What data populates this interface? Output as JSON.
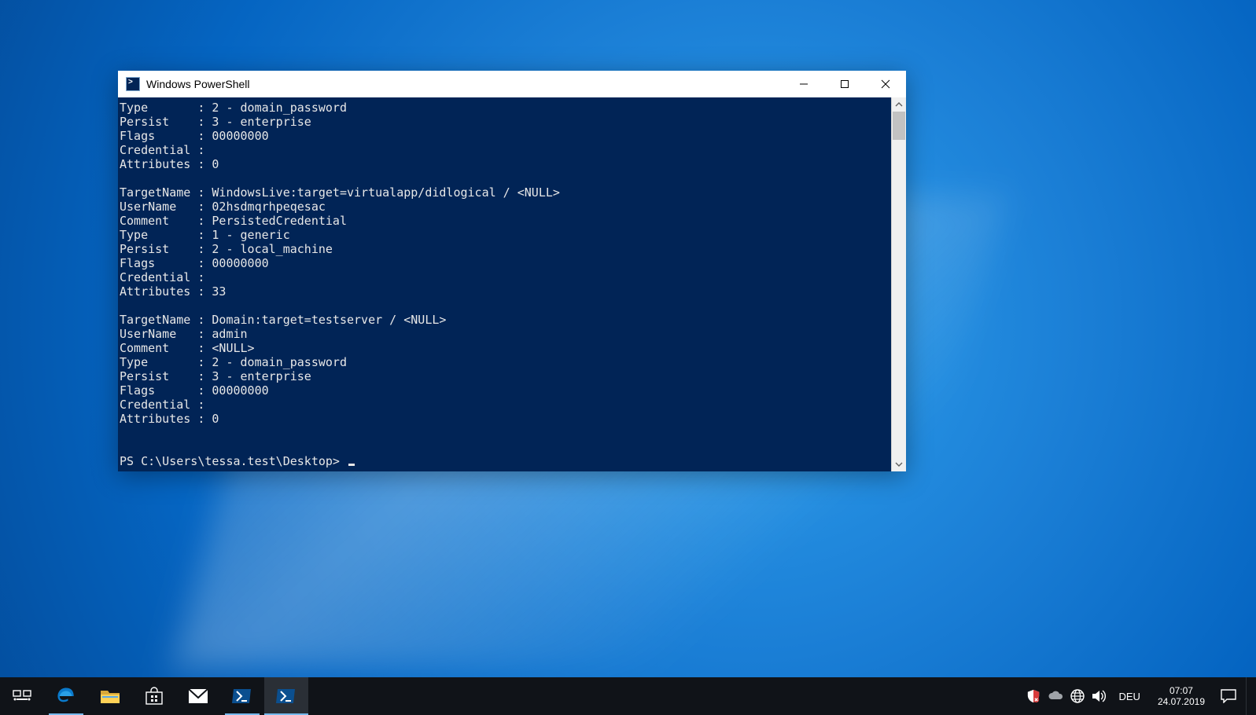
{
  "window": {
    "title": "Windows PowerShell",
    "controls": {
      "minimize": "—",
      "maximize": "▢",
      "close": "✕"
    }
  },
  "terminal": {
    "lines": [
      "Type       : 2 - domain_password",
      "Persist    : 3 - enterprise",
      "Flags      : 00000000",
      "Credential :",
      "Attributes : 0",
      "",
      "TargetName : WindowsLive:target=virtualapp/didlogical / <NULL>",
      "UserName   : 02hsdmqrhpeqesac",
      "Comment    : PersistedCredential",
      "Type       : 1 - generic",
      "Persist    : 2 - local_machine",
      "Flags      : 00000000",
      "Credential :",
      "Attributes : 33",
      "",
      "TargetName : Domain:target=testserver / <NULL>",
      "UserName   : admin",
      "Comment    : <NULL>",
      "Type       : 2 - domain_password",
      "Persist    : 3 - enterprise",
      "Flags      : 00000000",
      "Credential :",
      "Attributes : 0",
      "",
      ""
    ],
    "prompt": "PS C:\\Users\\tessa.test\\Desktop> "
  },
  "taskbar": {
    "items": [
      {
        "name": "task-view",
        "label": "Task View"
      },
      {
        "name": "edge",
        "label": "Microsoft Edge"
      },
      {
        "name": "file-explorer",
        "label": "File Explorer"
      },
      {
        "name": "store",
        "label": "Microsoft Store"
      },
      {
        "name": "mail",
        "label": "Mail"
      },
      {
        "name": "powershell-1",
        "label": "Windows PowerShell"
      },
      {
        "name": "powershell-2",
        "label": "Windows PowerShell (active)"
      }
    ],
    "tray": {
      "security": "Windows Security",
      "onedrive": "OneDrive",
      "network": "Network",
      "volume": "Volume",
      "language": "DEU",
      "time": "07:07",
      "date": "24.07.2019",
      "notifications": "Action Center"
    }
  }
}
